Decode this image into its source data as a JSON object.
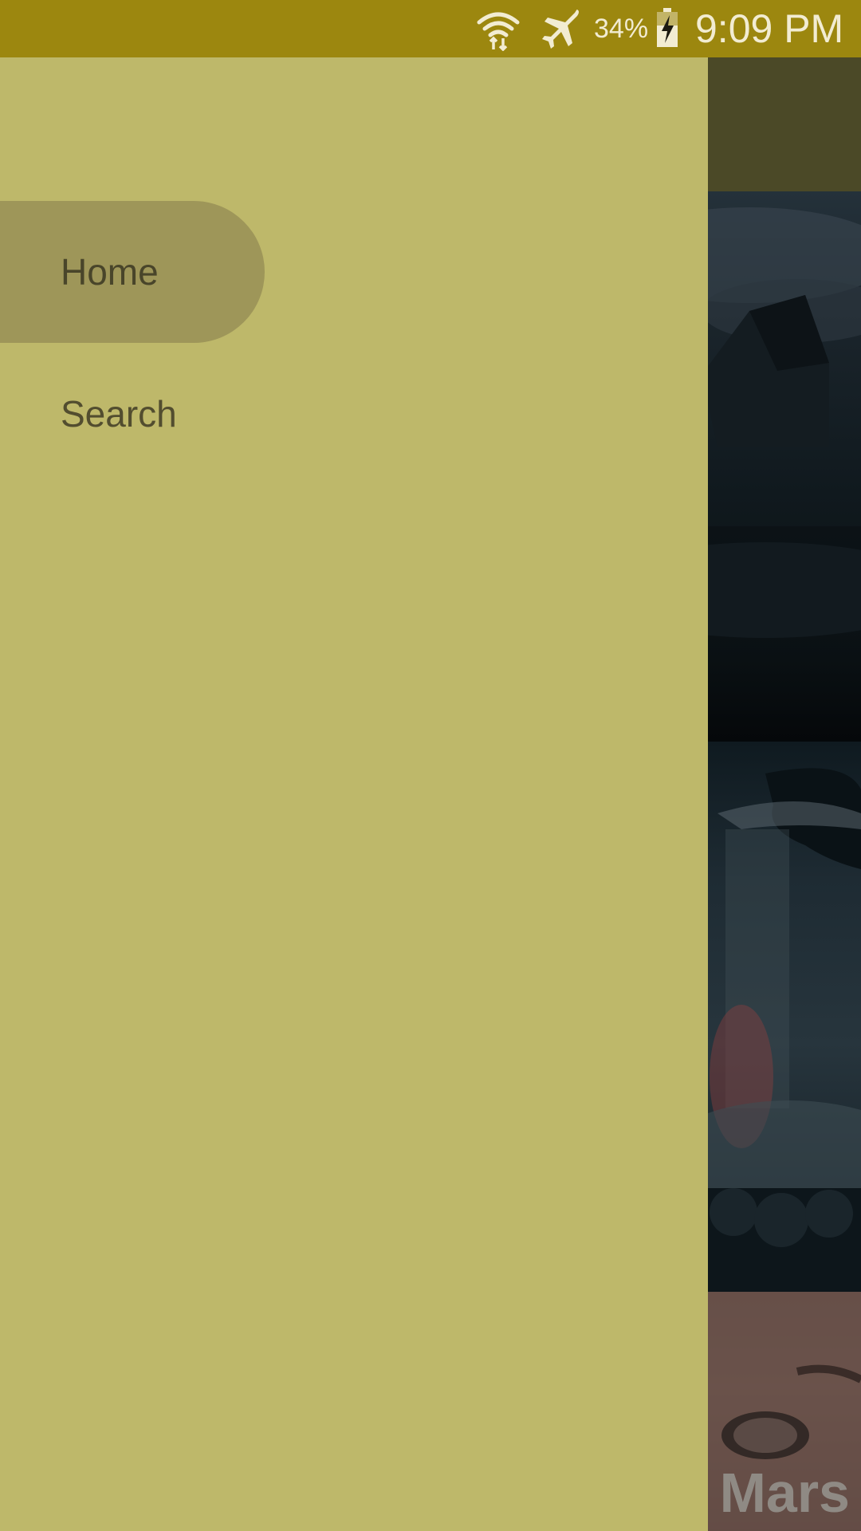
{
  "status_bar": {
    "battery_percent": "34%",
    "time": "9:09 PM",
    "icons": [
      "wifi-data-icon",
      "airplane-mode-icon",
      "battery-charging-icon"
    ],
    "background_color": "#9c870f"
  },
  "drawer": {
    "background_color": "#beb86a",
    "active_color": "#9e9659",
    "items": [
      {
        "label": "Home",
        "selected": true
      },
      {
        "label": "Search",
        "selected": false
      }
    ]
  },
  "background_content": {
    "toolbar_color": "#4b4927",
    "visible_poster_title_fragment": "Mars"
  }
}
